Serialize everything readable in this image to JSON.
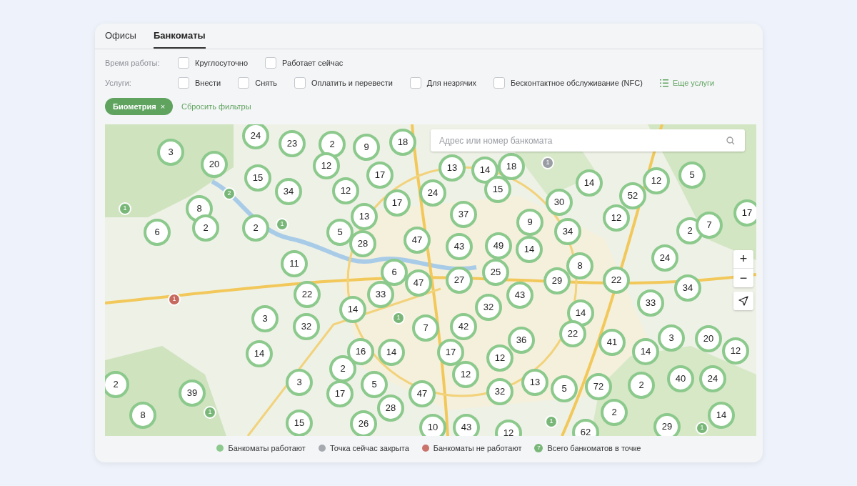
{
  "tabs": [
    {
      "label": "Офисы",
      "selected": false
    },
    {
      "label": "Банкоматы",
      "selected": true
    }
  ],
  "filters": [
    {
      "label": "Время работы:",
      "options": [
        {
          "label": "Круглосуточно",
          "checked": false
        },
        {
          "label": "Работает сейчас",
          "checked": false
        }
      ]
    },
    {
      "label": "Услуги:",
      "options": [
        {
          "label": "Внести",
          "checked": false
        },
        {
          "label": "Снять",
          "checked": false
        },
        {
          "label": "Оплатить и перевести",
          "checked": false
        },
        {
          "label": "Для незрячих",
          "checked": false
        },
        {
          "label": "Бесконтактное обслуживание (NFC)",
          "checked": false
        }
      ],
      "more": "Еще услуги"
    }
  ],
  "active_chips": [
    {
      "label": "Биометрия",
      "remove": "×"
    }
  ],
  "reset_link": "Сбросить фильтры",
  "map": {
    "search": {
      "placeholder": "Адрес или номер банкомата"
    },
    "zoom_in": "+",
    "zoom_out": "−",
    "markers": [
      {
        "kind": "cluster",
        "count": "24"
      },
      {
        "kind": "cluster",
        "count": "23"
      },
      {
        "kind": "cluster",
        "count": "2"
      },
      {
        "kind": "cluster",
        "count": "9"
      },
      {
        "kind": "cluster",
        "count": "18"
      },
      {
        "kind": "cluster",
        "count": "3"
      },
      {
        "kind": "cluster",
        "count": "20"
      },
      {
        "kind": "cluster",
        "count": "15"
      },
      {
        "kind": "cluster",
        "count": "12"
      },
      {
        "kind": "cluster",
        "count": "17"
      },
      {
        "kind": "cluster",
        "count": "13"
      },
      {
        "kind": "cluster",
        "count": "14"
      },
      {
        "kind": "cluster",
        "count": "18"
      },
      {
        "kind": "cluster",
        "count": "14"
      },
      {
        "kind": "cluster",
        "count": "12"
      },
      {
        "kind": "cluster",
        "count": "5"
      },
      {
        "kind": "cluster",
        "count": "34"
      },
      {
        "kind": "cluster",
        "count": "12"
      },
      {
        "kind": "cluster",
        "count": "17"
      },
      {
        "kind": "cluster",
        "count": "24"
      },
      {
        "kind": "cluster",
        "count": "15"
      },
      {
        "kind": "cluster",
        "count": "30"
      },
      {
        "kind": "cluster",
        "count": "52"
      },
      {
        "kind": "cluster",
        "count": "8"
      },
      {
        "kind": "cluster",
        "count": "2"
      },
      {
        "kind": "cluster",
        "count": "6"
      },
      {
        "kind": "cluster",
        "count": "2"
      },
      {
        "kind": "cluster",
        "count": "13"
      },
      {
        "kind": "cluster",
        "count": "37"
      },
      {
        "kind": "cluster",
        "count": "9"
      },
      {
        "kind": "cluster",
        "count": "12"
      },
      {
        "kind": "cluster",
        "count": "2"
      },
      {
        "kind": "cluster",
        "count": "7"
      },
      {
        "kind": "cluster",
        "count": "17"
      },
      {
        "kind": "cluster",
        "count": "5"
      },
      {
        "kind": "cluster",
        "count": "28"
      },
      {
        "kind": "cluster",
        "count": "47"
      },
      {
        "kind": "cluster",
        "count": "43"
      },
      {
        "kind": "cluster",
        "count": "49"
      },
      {
        "kind": "cluster",
        "count": "14"
      },
      {
        "kind": "cluster",
        "count": "34"
      },
      {
        "kind": "cluster",
        "count": "11"
      },
      {
        "kind": "cluster",
        "count": "6"
      },
      {
        "kind": "cluster",
        "count": "47"
      },
      {
        "kind": "cluster",
        "count": "27"
      },
      {
        "kind": "cluster",
        "count": "25"
      },
      {
        "kind": "cluster",
        "count": "8"
      },
      {
        "kind": "cluster",
        "count": "29"
      },
      {
        "kind": "cluster",
        "count": "22"
      },
      {
        "kind": "cluster",
        "count": "24"
      },
      {
        "kind": "cluster",
        "count": "22"
      },
      {
        "kind": "cluster",
        "count": "33"
      },
      {
        "kind": "cluster",
        "count": "14"
      },
      {
        "kind": "cluster",
        "count": "32"
      },
      {
        "kind": "cluster",
        "count": "43"
      },
      {
        "kind": "cluster",
        "count": "34"
      },
      {
        "kind": "cluster",
        "count": "33"
      },
      {
        "kind": "cluster",
        "count": "3"
      },
      {
        "kind": "cluster",
        "count": "32"
      },
      {
        "kind": "cluster",
        "count": "7"
      },
      {
        "kind": "cluster",
        "count": "42"
      },
      {
        "kind": "cluster",
        "count": "14"
      },
      {
        "kind": "cluster",
        "count": "22"
      },
      {
        "kind": "cluster",
        "count": "36"
      },
      {
        "kind": "cluster",
        "count": "41"
      },
      {
        "kind": "cluster",
        "count": "3"
      },
      {
        "kind": "cluster",
        "count": "20"
      },
      {
        "kind": "cluster",
        "count": "14"
      },
      {
        "kind": "cluster",
        "count": "12"
      },
      {
        "kind": "cluster",
        "count": "14"
      },
      {
        "kind": "cluster",
        "count": "16"
      },
      {
        "kind": "cluster",
        "count": "14"
      },
      {
        "kind": "cluster",
        "count": "17"
      },
      {
        "kind": "cluster",
        "count": "12"
      },
      {
        "kind": "cluster",
        "count": "2"
      },
      {
        "kind": "cluster",
        "count": "3"
      },
      {
        "kind": "cluster",
        "count": "5"
      },
      {
        "kind": "cluster",
        "count": "12"
      },
      {
        "kind": "cluster",
        "count": "13"
      },
      {
        "kind": "cluster",
        "count": "72"
      },
      {
        "kind": "cluster",
        "count": "2"
      },
      {
        "kind": "cluster",
        "count": "40"
      },
      {
        "kind": "cluster",
        "count": "24"
      },
      {
        "kind": "cluster",
        "count": "2"
      },
      {
        "kind": "cluster",
        "count": "39"
      },
      {
        "kind": "cluster",
        "count": "17"
      },
      {
        "kind": "cluster",
        "count": "47"
      },
      {
        "kind": "cluster",
        "count": "32"
      },
      {
        "kind": "cluster",
        "count": "5"
      },
      {
        "kind": "cluster",
        "count": "28"
      },
      {
        "kind": "cluster",
        "count": "2"
      },
      {
        "kind": "cluster",
        "count": "8"
      },
      {
        "kind": "cluster",
        "count": "15"
      },
      {
        "kind": "cluster",
        "count": "26"
      },
      {
        "kind": "cluster",
        "count": "10"
      },
      {
        "kind": "cluster",
        "count": "43"
      },
      {
        "kind": "cluster",
        "count": "29"
      },
      {
        "kind": "cluster",
        "count": "14"
      },
      {
        "kind": "cluster",
        "count": "12"
      },
      {
        "kind": "cluster",
        "count": "62"
      },
      {
        "kind": "point",
        "count": "1",
        "color": "#9a9da3"
      },
      {
        "kind": "point",
        "count": "2",
        "color": "#79b779"
      },
      {
        "kind": "point",
        "count": "1",
        "color": "#79b779"
      },
      {
        "kind": "point",
        "count": "1",
        "color": "#79b779"
      },
      {
        "kind": "point",
        "count": "1",
        "color": "#c66a5f"
      },
      {
        "kind": "point",
        "count": "1",
        "color": "#79b779"
      },
      {
        "kind": "point",
        "count": "1",
        "color": "#79b779"
      },
      {
        "kind": "point",
        "count": "1",
        "color": "#79b779"
      },
      {
        "kind": "point",
        "count": "1",
        "color": "#79b779"
      }
    ]
  },
  "legend": [
    {
      "kind": "dot",
      "label": "Банкоматы работают",
      "color": "#8cc98c"
    },
    {
      "kind": "dot",
      "label": "Точка сейчас закрыта",
      "color": "#a6a9ae"
    },
    {
      "kind": "dot",
      "label": "Банкоматы не работают",
      "color": "#c9736a"
    },
    {
      "kind": "count",
      "label": "Всего банкоматов в точке",
      "count": "7"
    }
  ]
}
